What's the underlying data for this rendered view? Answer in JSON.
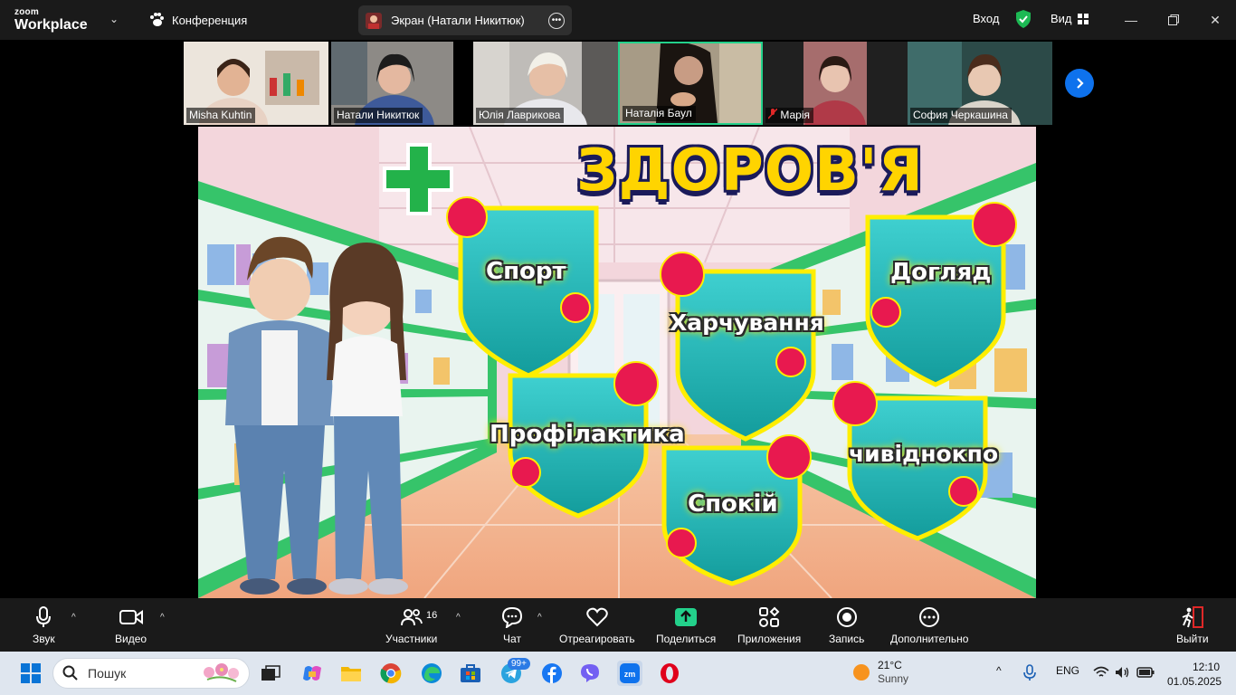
{
  "app": {
    "logo_top": "zoom",
    "logo_bottom": "Workplace",
    "conference_label": "Конференция",
    "screen_share_label": "Экран (Натали Никитюк)",
    "sign_in": "Вход",
    "view_label": "Вид"
  },
  "participants": [
    {
      "name": "Misha Kuhtin",
      "muted": false
    },
    {
      "name": "Натали Никитюк",
      "muted": false
    },
    {
      "name": "Юлія Лаврикова",
      "muted": false
    },
    {
      "name": "Наталія Баул",
      "muted": false,
      "active_speaker": true
    },
    {
      "name": "Марія",
      "muted": true
    },
    {
      "name": "София Черкашина",
      "muted": false
    }
  ],
  "slide": {
    "title": "ЗДОРОВ'Я",
    "shields": [
      "Спорт",
      "Харчування",
      "Догляд",
      "Профілактика",
      "Спокій",
      "чивіднокпо"
    ]
  },
  "controls": {
    "audio": "Звук",
    "video": "Видео",
    "participants": "Участники",
    "participants_count": "16",
    "chat": "Чат",
    "react": "Отреагировать",
    "share": "Поделиться",
    "apps": "Приложения",
    "record": "Запись",
    "more": "Дополнительно",
    "leave": "Выйти"
  },
  "taskbar": {
    "search_placeholder": "Пошук",
    "telegram_badge": "99+",
    "weather_temp": "21°C",
    "weather_desc": "Sunny",
    "language": "ENG",
    "time": "12:10",
    "date": "01.05.2025"
  },
  "colors": {
    "zoom_blue": "#0e72ed",
    "share_green": "#23d18b",
    "leave_red": "#e02828",
    "shield_teal": "#1fb2b2",
    "virus_red": "#e8194f"
  }
}
